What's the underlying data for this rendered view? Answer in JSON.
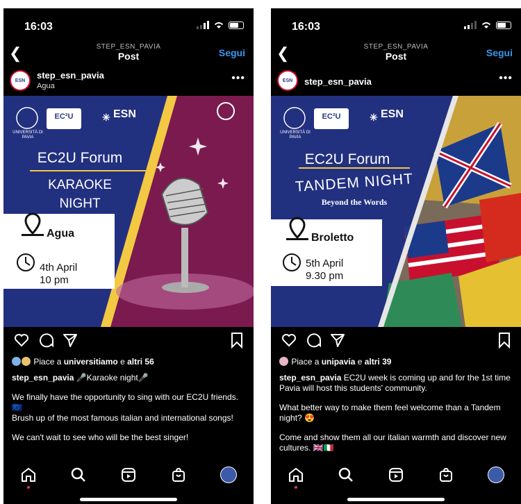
{
  "phones": [
    {
      "status": {
        "time": "16:03"
      },
      "nav": {
        "subtitle": "STEP_ESN_PAVIA",
        "title": "Post",
        "follow_label": "Segui"
      },
      "header": {
        "username": "step_esn_pavia",
        "location": "Agua"
      },
      "image": {
        "logos": {
          "university": "UNIVERSITÀ DI PAVIA",
          "ec2u": "EC²U",
          "esn": "ESN"
        },
        "forum_title": "EC2U Forum",
        "event_title_1": "KARAOKE",
        "event_title_2": "NIGHT",
        "venue": "Agua",
        "date": "4th April",
        "time": "10 pm"
      },
      "likes": {
        "prefix": "Piace a ",
        "user": "universitiamo",
        "middle": " e ",
        "others": "altri 56"
      },
      "caption": {
        "username": "step_esn_pavia",
        "first": " 🎤Karaoke night🎤",
        "lines": [
          "We finally have the opportunity to sing with our EC2U friends.🇪🇺",
          "Brush up of the most famous italian and international songs!",
          "We can't wait to see who will be the best singer!"
        ]
      }
    },
    {
      "status": {
        "time": "16:03"
      },
      "nav": {
        "subtitle": "STEP_ESN_PAVIA",
        "title": "Post",
        "follow_label": "Segui"
      },
      "header": {
        "username": "step_esn_pavia",
        "location": ""
      },
      "image": {
        "logos": {
          "university": "UNIVERSITÀ DI PAVIA",
          "ec2u": "EC²U",
          "esn": "ESN"
        },
        "forum_title": "EC2U Forum",
        "event_title_1": "TANDEM NIGHT",
        "event_subtitle": "Beyond the Words",
        "venue": "Broletto",
        "date": "5th April",
        "time": "9.30 pm"
      },
      "likes": {
        "prefix": "Piace a ",
        "user": "unipavia",
        "middle": " e ",
        "others": "altri 39"
      },
      "caption": {
        "username": "step_esn_pavia",
        "first": " EC2U week is coming up and for the 1st time Pavia will host this students' community.",
        "lines": [
          "What better way to make them  feel welcome than a Tandem night? 😍",
          "Come and show them all our italian warmth and discover new cultures. 🇬🇧🇮🇹"
        ]
      }
    }
  ],
  "colors": {
    "accent": "#3897f0",
    "poster_blue": "#223080",
    "karaoke_purple": "#7a1a4e",
    "esn_cyan": "#00aeef",
    "esn_magenta": "#ec008c"
  },
  "icons": [
    "back-icon",
    "more-icon",
    "heart-icon",
    "comment-icon",
    "share-icon",
    "bookmark-icon",
    "home-icon",
    "search-icon",
    "reels-icon",
    "shop-icon",
    "profile-icon",
    "location-pin-icon",
    "clock-icon",
    "microphone-icon"
  ]
}
